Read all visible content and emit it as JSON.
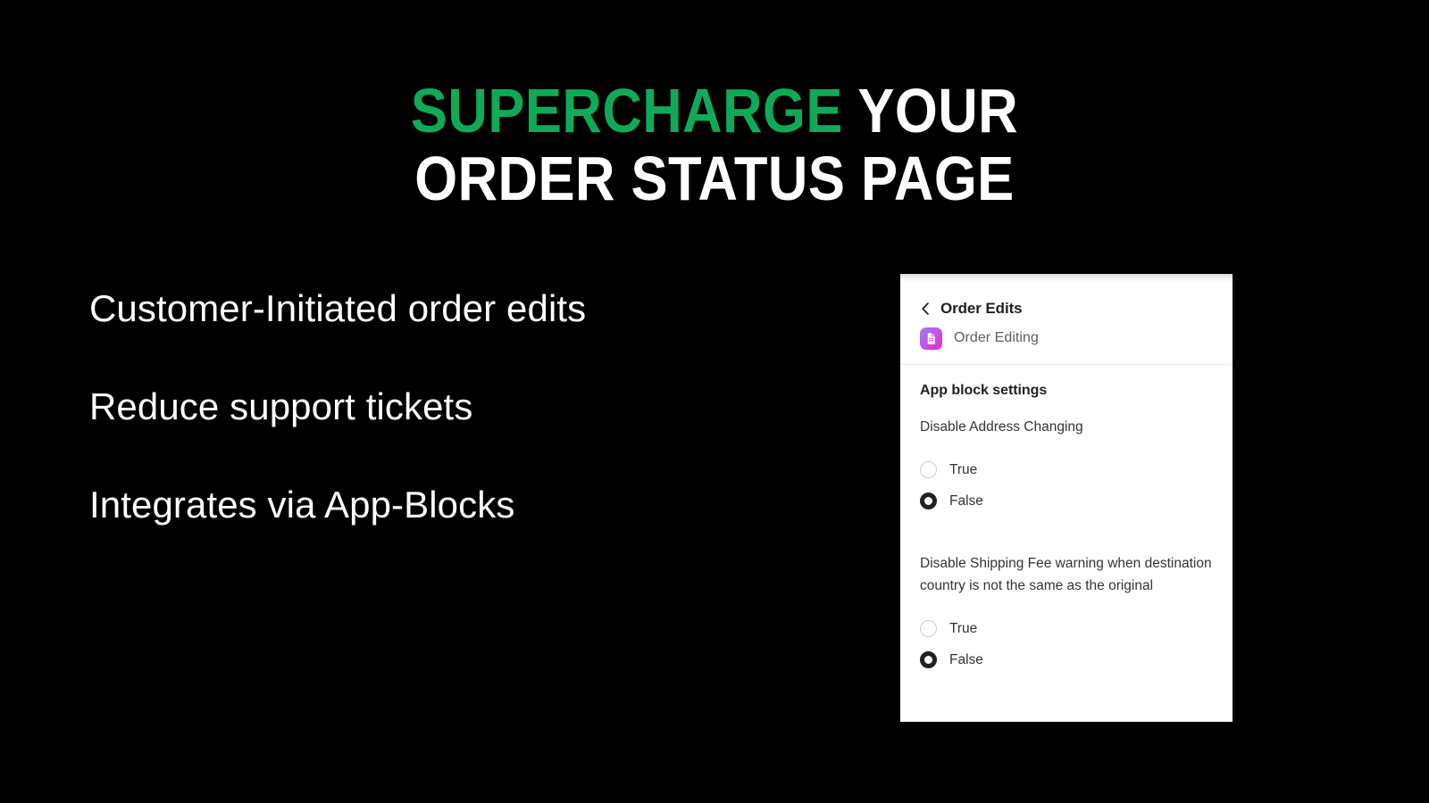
{
  "hero": {
    "line1_accent": "SUPERCHARGE",
    "line1_rest": " YOUR",
    "line2": "ORDER STATUS PAGE",
    "accent_color": "#0FAA57",
    "text_color": "#FFFFFF",
    "background_color": "#000000"
  },
  "features": [
    {
      "text": "Customer-Initiated order edits"
    },
    {
      "text": "Reduce support tickets"
    },
    {
      "text": "Integrates via App-Blocks"
    }
  ],
  "card": {
    "back_icon": "chevron-left-icon",
    "breadcrumb_title": "Order Edits",
    "app_icon": "order-editing-app-icon",
    "app_name": "Order Editing",
    "section_title": "App block settings",
    "settings": [
      {
        "label": "Disable Address Changing",
        "options": [
          {
            "label": "True",
            "selected": false
          },
          {
            "label": "False",
            "selected": true
          }
        ]
      },
      {
        "label": "Disable Shipping Fee warning when destination country is not the same as the original",
        "options": [
          {
            "label": "True",
            "selected": false
          },
          {
            "label": "False",
            "selected": true
          }
        ]
      }
    ]
  }
}
